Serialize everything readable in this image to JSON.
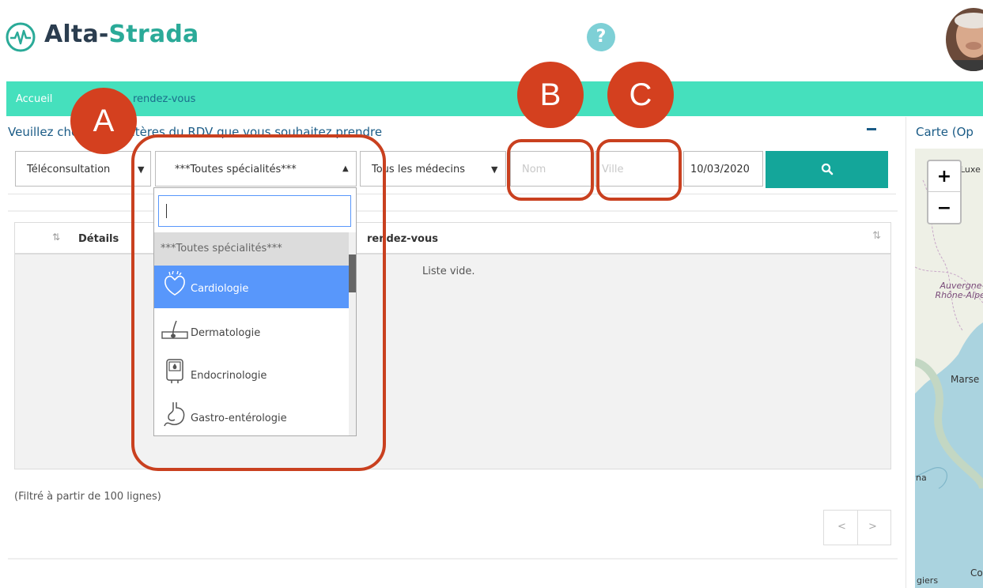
{
  "header": {
    "brand_part1": "Alta-",
    "brand_part2": "Strada",
    "help_symbol": "?",
    "brand_color": "#2aaa98",
    "icons": [
      "logo-pulse-icon",
      "help-icon",
      "user-avatar"
    ]
  },
  "breadcrumb": {
    "home": "Accueil",
    "current": "rendez-vous"
  },
  "search": {
    "title": "Veuillez choisir les critères du RDV que vous souhaitez prendre",
    "consultation_type": "Téléconsultation",
    "specialty": "***Toutes spécialités***",
    "doctor": "Tous les médecins",
    "name_placeholder": "Nom",
    "city_placeholder": "Ville",
    "date": "10/03/2020",
    "button_icon": "search-icon",
    "button_color": "#14a69a"
  },
  "dropdown": {
    "items": [
      {
        "label": "***Toutes spécialités***",
        "icon": ""
      },
      {
        "label": "Cardiologie",
        "icon": "heart-icon"
      },
      {
        "label": "Dermatologie",
        "icon": "skin-icon"
      },
      {
        "label": "Endocrinologie",
        "icon": "glucose-meter-icon"
      },
      {
        "label": "Gastro-entérologie",
        "icon": "stomach-icon"
      }
    ],
    "selected_index": 1
  },
  "table": {
    "col_details": "Détails",
    "col_rdv": "rendez-vous",
    "empty": "Liste vide."
  },
  "filter_info": "(Filtré à partir de 100 lignes)",
  "pager": {
    "prev": "<",
    "next": ">"
  },
  "map": {
    "title": "Carte (Op",
    "zoom_in": "+",
    "zoom_out": "−",
    "labels": {
      "luxe": "Luxe",
      "region": "Auvergne-Rhône-Alpes",
      "marse": "Marse",
      "na": "na",
      "giers": "giers",
      "co": "Co"
    }
  },
  "callouts": {
    "a": "A",
    "b": "B",
    "c": "C",
    "color": "#d4401f"
  }
}
